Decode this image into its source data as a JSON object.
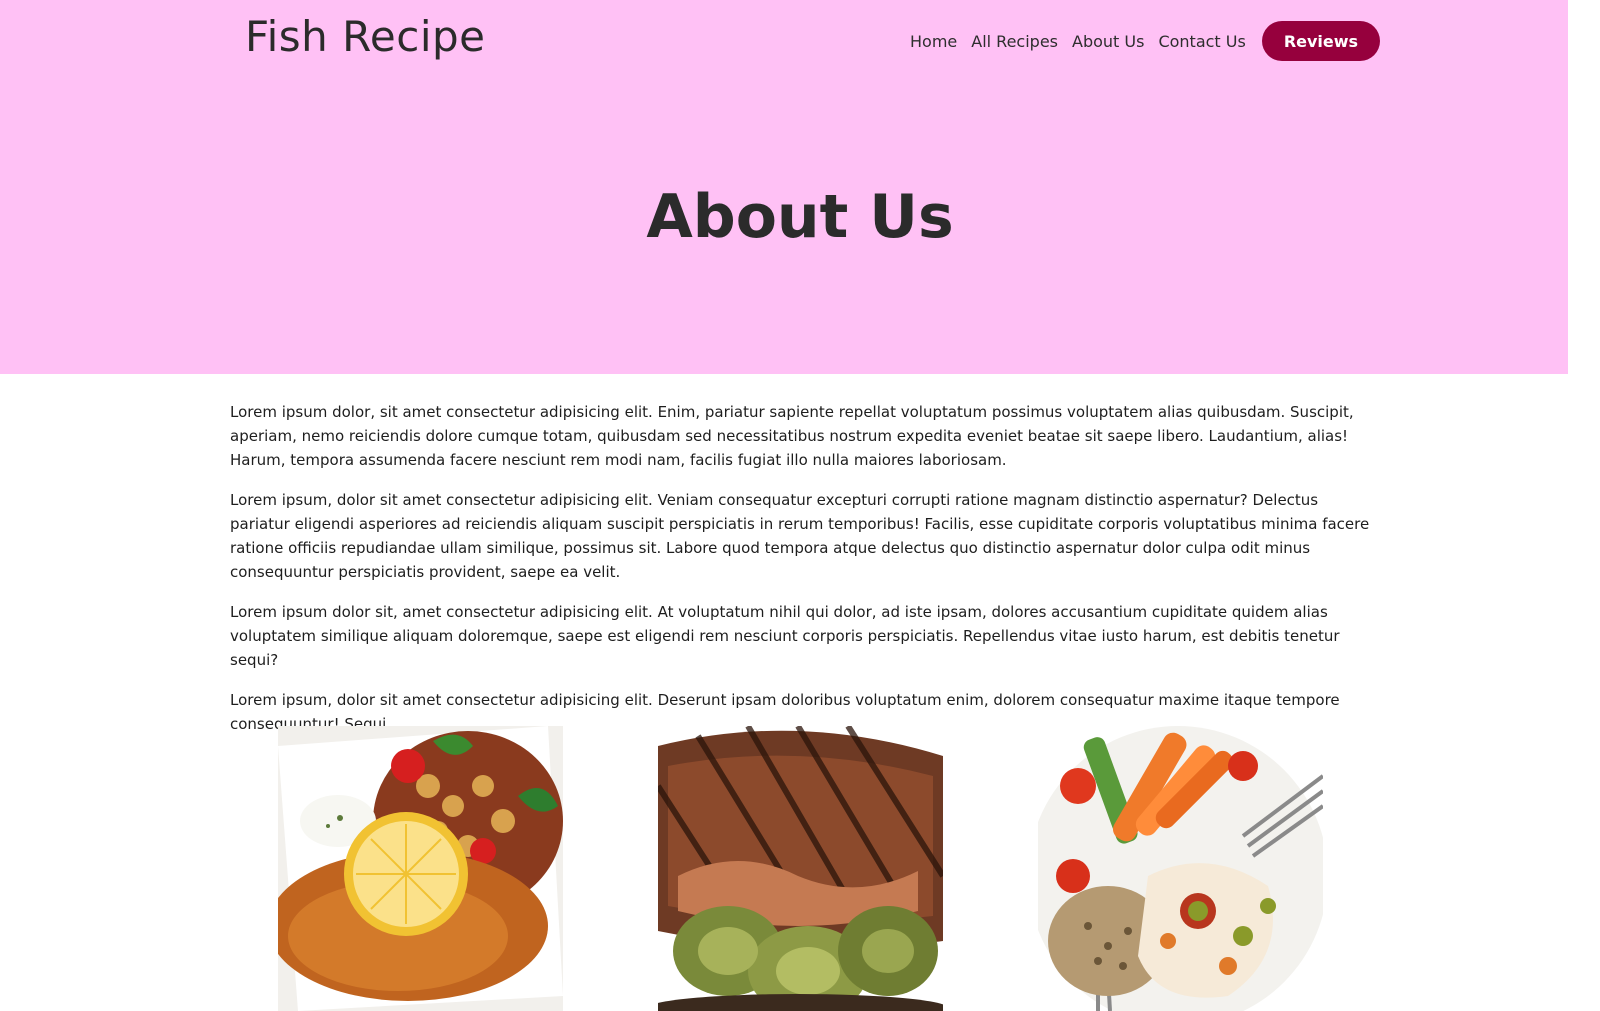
{
  "header": {
    "brand": "Fish Recipe",
    "nav": [
      "Home",
      "All Recipes",
      "About Us",
      "Contact Us"
    ],
    "reviews_label": "Reviews"
  },
  "hero": {
    "title": "About Us"
  },
  "content": {
    "paragraphs": [
      "Lorem ipsum dolor, sit amet consectetur adipisicing elit. Enim, pariatur sapiente repellat voluptatum possimus voluptatem alias quibusdam. Suscipit, aperiam, nemo reiciendis dolore cumque totam, quibusdam sed necessitatibus nostrum expedita eveniet beatae sit saepe libero. Laudantium, alias! Harum, tempora assumenda facere nesciunt rem modi nam, facilis fugiat illo nulla maiores laboriosam.",
      "Lorem ipsum, dolor sit amet consectetur adipisicing elit. Veniam consequatur excepturi corrupti ratione magnam distinctio aspernatur? Delectus pariatur eligendi asperiores ad reiciendis aliquam suscipit perspiciatis in rerum temporibus! Facilis, esse cupiditate corporis voluptatibus minima facere ratione officiis repudiandae ullam similique, possimus sit. Labore quod tempora atque delectus quo distinctio aspernatur dolor culpa odit minus consequuntur perspiciatis provident, saepe ea velit.",
      "Lorem ipsum dolor sit, amet consectetur adipisicing elit. At voluptatum nihil qui dolor, ad iste ipsam, dolores accusantium cupiditate quidem alias voluptatem similique aliquam doloremque, saepe est eligendi rem nesciunt corporis perspiciatis. Repellendus vitae iusto harum, est debitis tenetur sequi?",
      "Lorem ipsum, dolor sit amet consectetur adipisicing elit. Deserunt ipsam doloribus voluptatum enim, dolorem consequatur maxime itaque tempore consequuntur! Sequi."
    ]
  },
  "colors": {
    "hero_bg": "#ffc1f5",
    "accent": "#96003d",
    "text": "#2b2b2b"
  }
}
